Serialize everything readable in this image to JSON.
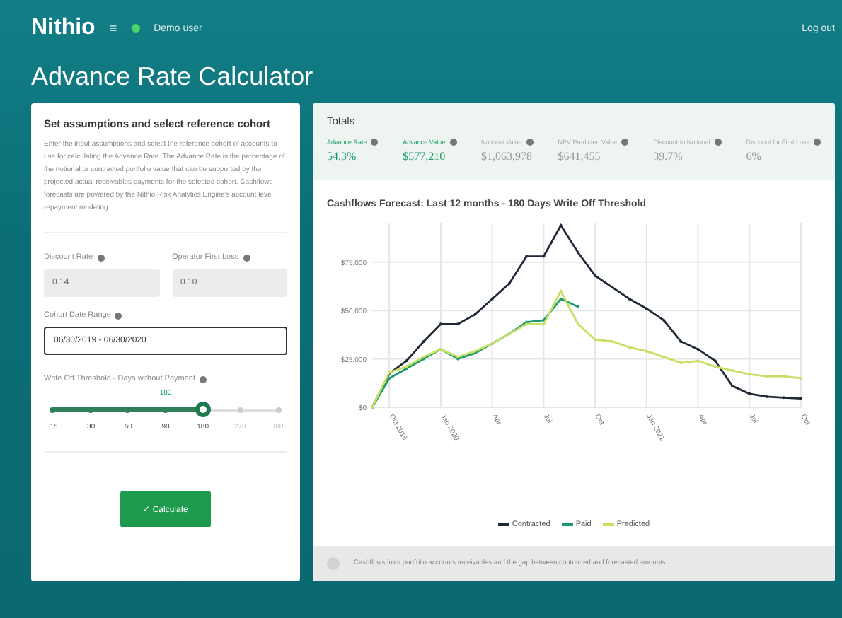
{
  "nav": {
    "brand": "Nithio",
    "menu": "≡",
    "user": "Demo user",
    "logout": "Log out"
  },
  "page_title": "Advance Rate Calculator",
  "assumptions": {
    "title": "Set assumptions and select reference cohort",
    "description": "Enter the input assumptions and select the reference cohort of accounts to use for calculating the Advance Rate. The Advance Rate is the percentage of the notional or contracted portfolio value that can be supported by the projected actual receivables payments for the selected cohort. Cashflows forecasts are powered by the Nithio Risk Analytics Engine's account level repayment modeling.",
    "fields": [
      {
        "label": "Discount Rate",
        "value": "0.14",
        "disabled": true
      },
      {
        "label": "Operator First Loss",
        "value": "0.10",
        "disabled": true
      }
    ],
    "date_range": {
      "label": "Cohort Date Range",
      "value": "06/30/2019 - 06/30/2020"
    },
    "slider": {
      "label": "Write Off Threshold - Days without Payment",
      "reading": "180",
      "level": 0.667,
      "ticks": [
        "15",
        "30",
        "60",
        "90",
        "180",
        "270",
        "360"
      ]
    },
    "button_icon": "✓",
    "button": "Calculate"
  },
  "totals": {
    "title": "Totals",
    "items": [
      {
        "label": "Advance Rate",
        "value": "54.3%",
        "highlighted": true
      },
      {
        "label": "Advance Value",
        "value": "$577,210",
        "highlighted": true
      },
      {
        "label": "Notional Value",
        "value": "$1,063,978",
        "highlighted": false
      },
      {
        "label": "NPV Predicted Value",
        "value": "$641,455",
        "highlighted": false
      },
      {
        "label": "Discount to Notional",
        "value": "39.7%",
        "highlighted": false
      },
      {
        "label": "Discount for First Loss",
        "value": "6%",
        "highlighted": false
      }
    ]
  },
  "chart": {
    "title": "Cashflows Forecast: Last 12 months - 180 Days Write Off Threshold",
    "chart_data": {
      "type": "line",
      "grid": true,
      "categories": [
        null,
        "Oct 2019",
        null,
        null,
        "Jan 2020",
        null,
        null,
        "Apr",
        null,
        null,
        "Jul",
        null,
        null,
        "Oct",
        null,
        null,
        "Jan 2021",
        null,
        null,
        "Apr",
        null,
        null,
        "Jul",
        null,
        null,
        "Oct"
      ],
      "ylim": [
        0,
        95000
      ],
      "yticks": [
        {
          "value": 0,
          "label": "$0"
        },
        {
          "value": 25000,
          "label": "$25,000"
        },
        {
          "value": 50000,
          "label": "$50,000"
        },
        {
          "value": 75000,
          "label": "$75,000"
        }
      ],
      "series": [
        {
          "name": "Contracted",
          "color": "#1f2937",
          "values": [
            0,
            17500,
            24000,
            34000,
            43000,
            43000,
            48000,
            56000,
            64000,
            78000,
            78000,
            94000,
            80000,
            68000,
            62000,
            56000,
            51000,
            45000,
            34000,
            30000,
            24000,
            11000,
            7000,
            5500,
            5000,
            4500
          ]
        },
        {
          "name": "Paid",
          "color": "#1a9a6c",
          "values": [
            0,
            15000,
            20000,
            25000,
            30000,
            25000,
            28000,
            33000,
            38000,
            44000,
            45000,
            56000,
            52000,
            null,
            null,
            null,
            null,
            null,
            null,
            null,
            null,
            null,
            null,
            null,
            null,
            null
          ]
        },
        {
          "name": "Predicted",
          "color": "#c5e063",
          "values": [
            0,
            18000,
            21000,
            26000,
            30000,
            26000,
            29000,
            33000,
            38000,
            43000,
            43000,
            60000,
            43000,
            35000,
            34000,
            31000,
            29000,
            26000,
            23000,
            24000,
            21000,
            19000,
            17000,
            16000,
            16000,
            15000
          ]
        }
      ]
    },
    "note": "Cashflows from portfolio accounts receivables and the gap between contracted and forecasted amounts."
  }
}
